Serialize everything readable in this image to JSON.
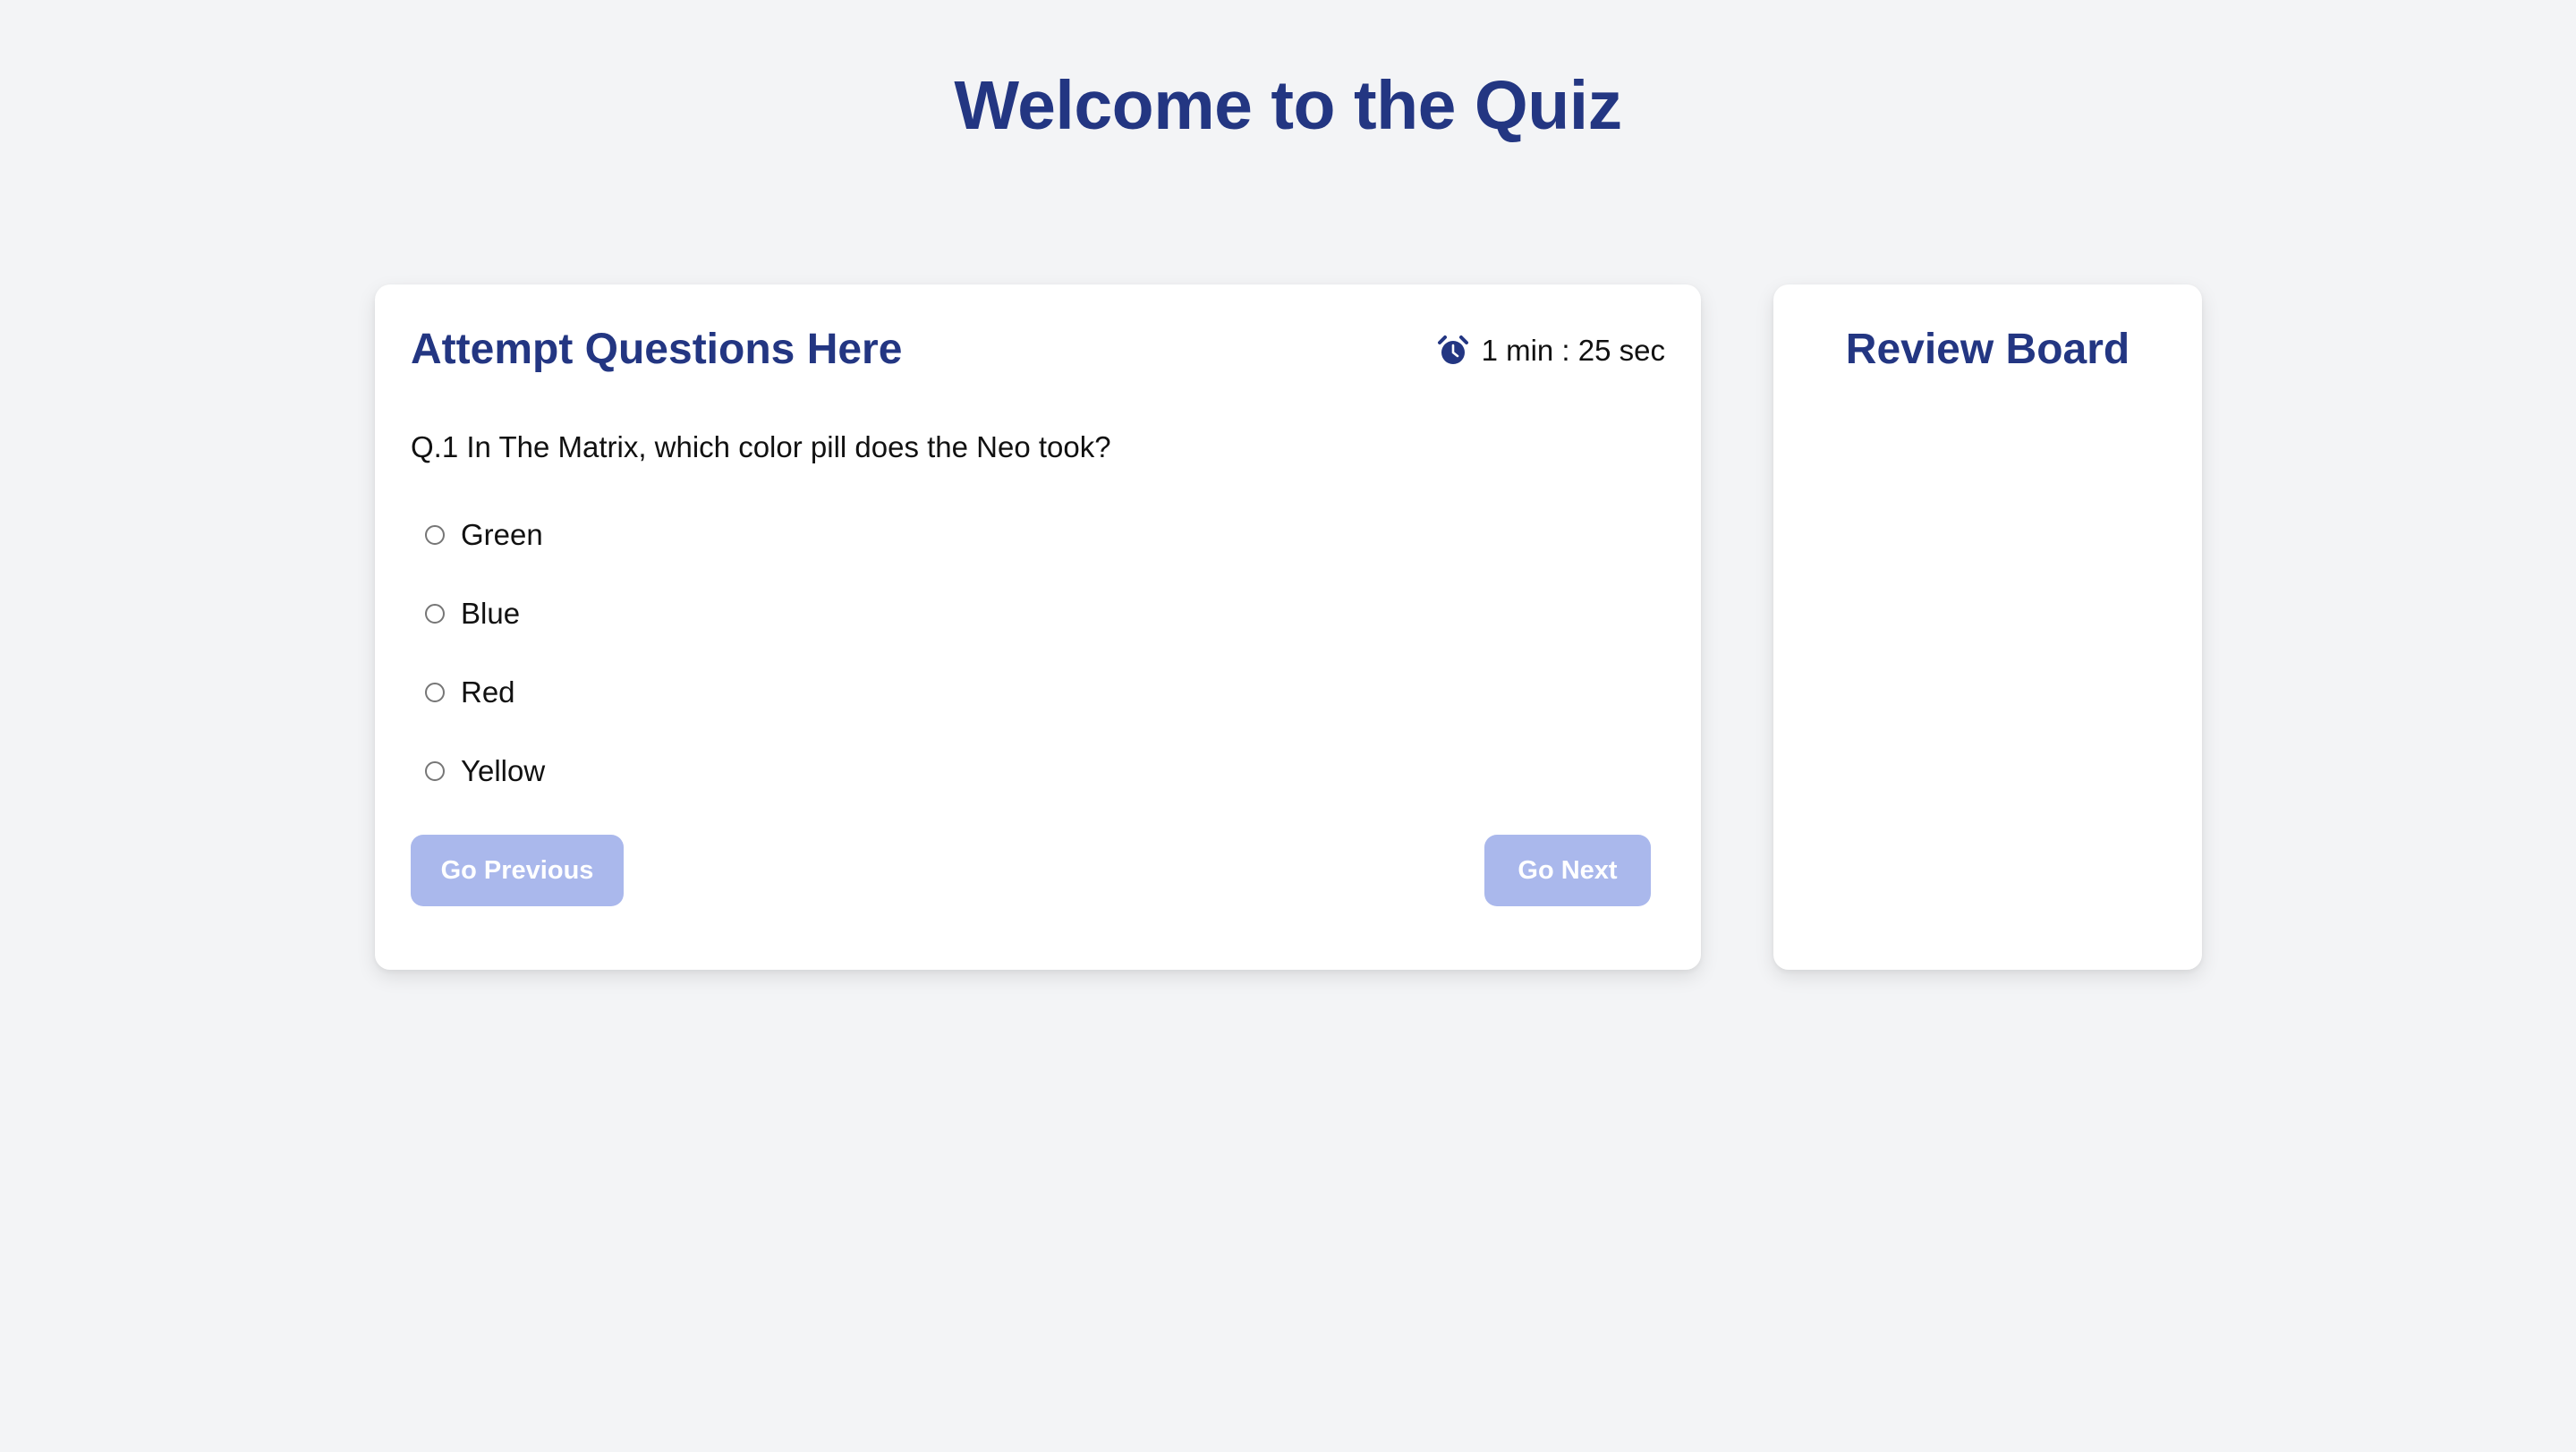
{
  "page": {
    "title": "Welcome to the Quiz"
  },
  "quiz": {
    "title": "Attempt Questions Here",
    "timer": {
      "icon": "alarm-clock-icon",
      "text": "1 min : 25 sec"
    },
    "question": "Q.1 In The Matrix, which color pill does the Neo took?",
    "options": [
      {
        "label": "Green",
        "selected": false
      },
      {
        "label": "Blue",
        "selected": false
      },
      {
        "label": "Red",
        "selected": false
      },
      {
        "label": "Yellow",
        "selected": false
      }
    ],
    "buttons": {
      "previous": "Go Previous",
      "next": "Go Next"
    }
  },
  "review": {
    "title": "Review Board"
  },
  "colors": {
    "background": "#f3f4f6",
    "card": "#ffffff",
    "accent": "#233682",
    "button": "#aab8ec",
    "button_text": "#ffffff"
  }
}
